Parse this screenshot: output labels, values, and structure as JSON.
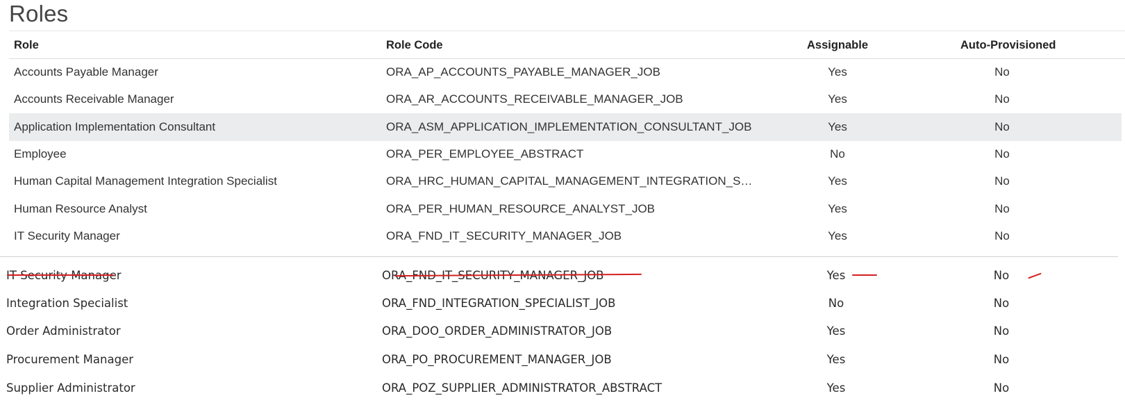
{
  "page": {
    "title": "Roles"
  },
  "table": {
    "columns": [
      "Role",
      "Role Code",
      "Assignable",
      "Auto-Provisioned"
    ],
    "rows": [
      {
        "role": "Accounts Payable Manager",
        "code": "ORA_AP_ACCOUNTS_PAYABLE_MANAGER_JOB",
        "assignable": "Yes",
        "auto": "No"
      },
      {
        "role": "Accounts Receivable Manager",
        "code": "ORA_AR_ACCOUNTS_RECEIVABLE_MANAGER_JOB",
        "assignable": "Yes",
        "auto": "No"
      },
      {
        "role": "Application Implementation Consultant",
        "code": "ORA_ASM_APPLICATION_IMPLEMENTATION_CONSULTANT_JOB",
        "assignable": "Yes",
        "auto": "No",
        "selected": true
      },
      {
        "role": "Employee",
        "code": "ORA_PER_EMPLOYEE_ABSTRACT",
        "assignable": "No",
        "auto": "No"
      },
      {
        "role": "Human Capital Management Integration Specialist",
        "code": "ORA_HRC_HUMAN_CAPITAL_MANAGEMENT_INTEGRATION_S…",
        "assignable": "Yes",
        "auto": "No"
      },
      {
        "role": "Human Resource Analyst",
        "code": "ORA_PER_HUMAN_RESOURCE_ANALYST_JOB",
        "assignable": "Yes",
        "auto": "No"
      },
      {
        "role": "IT Security Manager",
        "code": "ORA_FND_IT_SECURITY_MANAGER_JOB",
        "assignable": "Yes",
        "auto": "No"
      }
    ]
  },
  "appended_rows": [
    {
      "role": "IT Security Manager",
      "code": "ORA_FND_IT_SECURITY_MANAGER_JOB",
      "assignable": "Yes",
      "auto": "No",
      "struck_out": true
    },
    {
      "role": "Integration Specialist",
      "code": "ORA_FND_INTEGRATION_SPECIALIST_JOB",
      "assignable": "No",
      "auto": "No"
    },
    {
      "role": "Order Administrator",
      "code": "ORA_DOO_ORDER_ADMINISTRATOR_JOB",
      "assignable": "Yes",
      "auto": "No"
    },
    {
      "role": "Procurement Manager",
      "code": "ORA_PO_PROCUREMENT_MANAGER_JOB",
      "assignable": "Yes",
      "auto": "No"
    },
    {
      "role": "Supplier Administrator",
      "code": "ORA_POZ_SUPPLIER_ADMINISTRATOR_ABSTRACT",
      "assignable": "Yes",
      "auto": "No"
    }
  ],
  "colors": {
    "selected_row_bg": "#ebecee",
    "strike_mark": "#d42020"
  }
}
